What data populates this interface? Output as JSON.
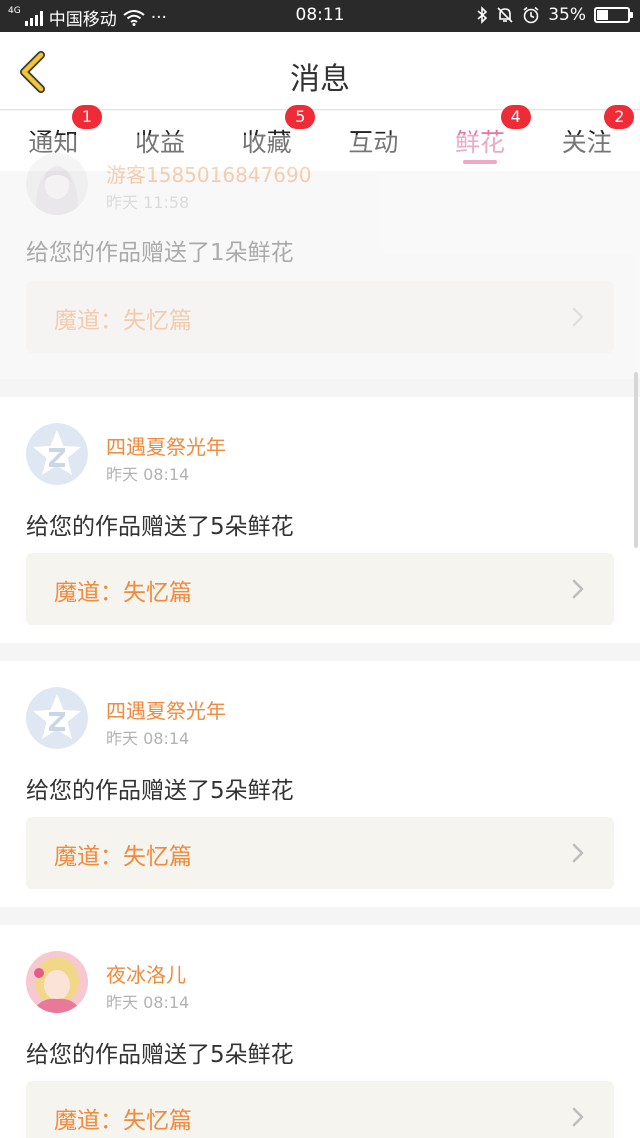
{
  "status": {
    "network": "4G",
    "carrier": "中国移动",
    "dots": "···",
    "time": "08:11",
    "battery": "35%",
    "battery_level": 0.35
  },
  "header": {
    "title": "消息"
  },
  "tabs": [
    {
      "label": "通知",
      "badge": "1"
    },
    {
      "label": "收益",
      "badge": ""
    },
    {
      "label": "收藏",
      "badge": "5"
    },
    {
      "label": "互动",
      "badge": ""
    },
    {
      "label": "鲜花",
      "badge": "4",
      "active": true
    },
    {
      "label": "关注",
      "badge": "2"
    }
  ],
  "messages": [
    {
      "name": "游客1585016847690",
      "time": "昨天 11:58",
      "text": "给您的作品赠送了1朵鲜花",
      "work": "魔道：失忆篇",
      "avatar": "illustrated-girl-avatar"
    },
    {
      "name": "四遇夏祭光年",
      "time": "昨天 08:14",
      "text": "给您的作品赠送了5朵鲜花",
      "work": "魔道：失忆篇",
      "avatar": "default-star-avatar"
    },
    {
      "name": "四遇夏祭光年",
      "time": "昨天 08:14",
      "text": "给您的作品赠送了5朵鲜花",
      "work": "魔道：失忆篇",
      "avatar": "default-star-avatar"
    },
    {
      "name": "夜冰洛儿",
      "time": "昨天 08:14",
      "text": "给您的作品赠送了5朵鲜花",
      "work": "魔道：失忆篇",
      "avatar": "pink-photo-avatar"
    }
  ],
  "colors": {
    "accent_pink": "#e7759e",
    "name_orange": "#f08a3c",
    "badge_red": "#ee2b36",
    "back_yellow": "#f3c533"
  }
}
